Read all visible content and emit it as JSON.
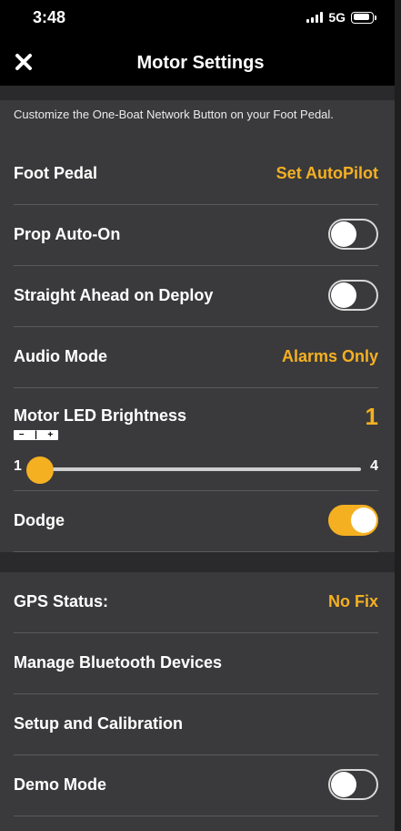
{
  "status": {
    "time": "3:48",
    "network": "5G"
  },
  "nav": {
    "title": "Motor Settings",
    "close_icon": "close-icon"
  },
  "description": "Customize the One-Boat Network Button on your Foot Pedal.",
  "settings": {
    "foot_pedal": {
      "label": "Foot Pedal",
      "value": "Set AutoPilot"
    },
    "prop_auto_on": {
      "label": "Prop Auto-On",
      "enabled": false
    },
    "straight_ahead": {
      "label": "Straight Ahead on Deploy",
      "enabled": false
    },
    "audio_mode": {
      "label": "Audio Mode",
      "value": "Alarms Only"
    },
    "led_brightness": {
      "label": "Motor LED Brightness",
      "value": "1",
      "control_minus": "−",
      "control_sep": "|",
      "control_plus": "+",
      "slider_min": "1",
      "slider_max": "4",
      "level": 1
    },
    "dodge": {
      "label": "Dodge",
      "enabled": true
    }
  },
  "system": {
    "gps_status": {
      "label": "GPS Status:",
      "value": "No Fix"
    },
    "bluetooth": {
      "label": "Manage Bluetooth Devices"
    },
    "setup": {
      "label": "Setup and Calibration"
    },
    "demo_mode": {
      "label": "Demo Mode",
      "enabled": false
    }
  },
  "colors": {
    "accent": "#f5b022",
    "background": "#3a3a3c",
    "separator": "#5a5a5c"
  }
}
